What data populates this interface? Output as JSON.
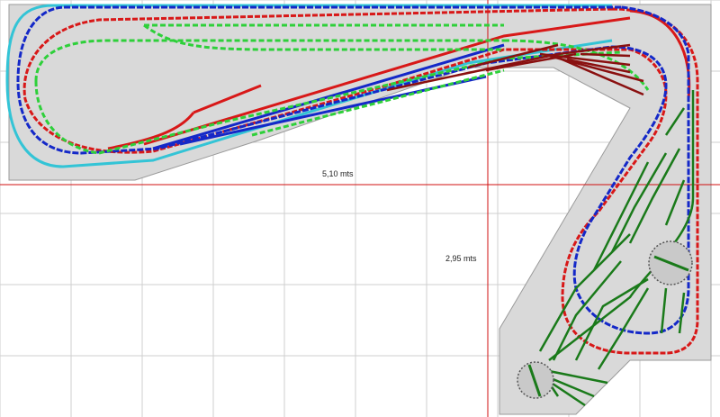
{
  "dimensions": {
    "width_label": "5,10 mts",
    "depth_label": "2,95 mts"
  },
  "colors": {
    "grid": "#cfcfcf",
    "baseboard": "#d9d9d9",
    "baseboard_edge": "#9a9a9a",
    "guide": "#d01010",
    "loop_cyan": "#33c4d6",
    "main_red": "#d81818",
    "main_blue": "#1428c8",
    "hidden_green": "#2ed03a",
    "yard_darkred": "#8a1010",
    "yard_green": "#1a7a1a",
    "turntable_fill": "#c9c9c9"
  },
  "legend_tracks": [
    "cyan",
    "red",
    "blue",
    "green",
    "darkred",
    "darkgreen"
  ]
}
